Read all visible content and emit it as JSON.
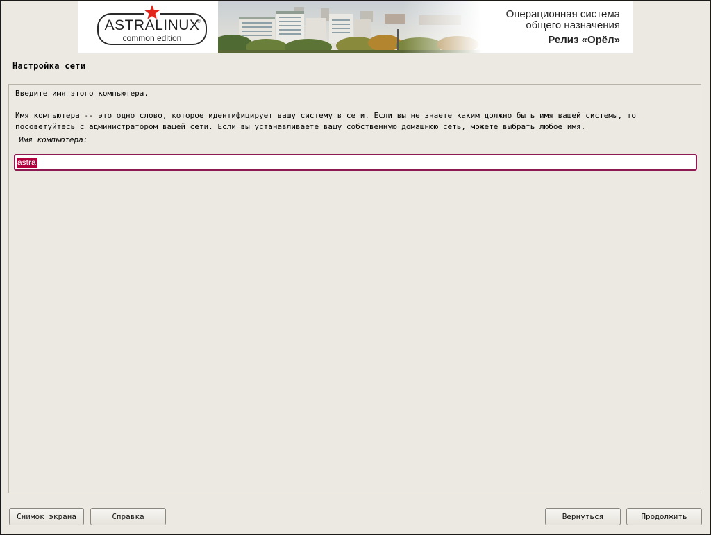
{
  "banner": {
    "logo": {
      "name": "ASTRALINUX",
      "registered": "®",
      "edition": "common edition"
    },
    "os_line1": "Операционная система",
    "os_line2": "общего назначения",
    "release": "Релиз «Орёл»",
    "star_icon": "red-star-icon"
  },
  "page": {
    "title": "Настройка сети"
  },
  "panel": {
    "prompt": "Введите имя этого компьютера.",
    "description_line1": "Имя компьютера -- это одно слово, которое идентифицирует вашу систему в сети. Если вы не знаете каким должно быть имя вашей системы, то",
    "description_line2": "посоветуйтесь с администратором вашей сети. Если вы устанавливаете вашу собственную домашнюю сеть, можете выбрать любое имя.",
    "hostname_label": "Имя компьютера:",
    "hostname_value": "astra"
  },
  "buttons": {
    "screenshot": "Снимок экрана",
    "help": "Справка",
    "back": "Вернуться",
    "continue": "Продолжить"
  },
  "colors": {
    "background": "#ece9e2",
    "accent": "#8c1a50",
    "selection": "#b0003e",
    "star": "#e1251b"
  }
}
